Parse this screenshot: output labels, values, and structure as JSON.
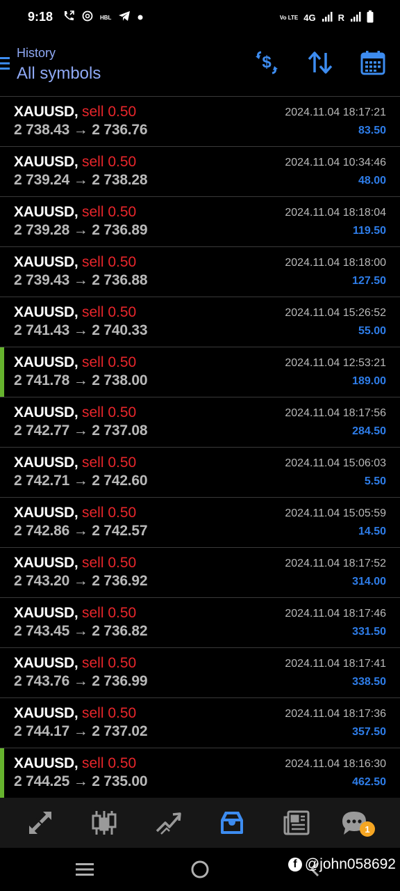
{
  "status_bar": {
    "time": "9:18",
    "left_icons": [
      "call-forward-icon",
      "threads-icon",
      "hbl-icon",
      "telegram-icon",
      "dot-icon"
    ],
    "hbl_text": "HBL",
    "volte_text": "Vo LTE",
    "network": "4G",
    "roaming": "R"
  },
  "header": {
    "subtitle": "History",
    "title": "All symbols",
    "accent_color": "#3d8cf0"
  },
  "deals": [
    {
      "symbol": "XAUUSD,",
      "side": "sell 0.50",
      "open": "2 738.43",
      "close": "2 736.76",
      "time": "2024.11.04 18:17:21",
      "profit": "83.50",
      "marked": false
    },
    {
      "symbol": "XAUUSD,",
      "side": "sell 0.50",
      "open": "2 739.24",
      "close": "2 738.28",
      "time": "2024.11.04 10:34:46",
      "profit": "48.00",
      "marked": false
    },
    {
      "symbol": "XAUUSD,",
      "side": "sell 0.50",
      "open": "2 739.28",
      "close": "2 736.89",
      "time": "2024.11.04 18:18:04",
      "profit": "119.50",
      "marked": false
    },
    {
      "symbol": "XAUUSD,",
      "side": "sell 0.50",
      "open": "2 739.43",
      "close": "2 736.88",
      "time": "2024.11.04 18:18:00",
      "profit": "127.50",
      "marked": false
    },
    {
      "symbol": "XAUUSD,",
      "side": "sell 0.50",
      "open": "2 741.43",
      "close": "2 740.33",
      "time": "2024.11.04 15:26:52",
      "profit": "55.00",
      "marked": false
    },
    {
      "symbol": "XAUUSD,",
      "side": "sell 0.50",
      "open": "2 741.78",
      "close": "2 738.00",
      "time": "2024.11.04 12:53:21",
      "profit": "189.00",
      "marked": true
    },
    {
      "symbol": "XAUUSD,",
      "side": "sell 0.50",
      "open": "2 742.77",
      "close": "2 737.08",
      "time": "2024.11.04 18:17:56",
      "profit": "284.50",
      "marked": false
    },
    {
      "symbol": "XAUUSD,",
      "side": "sell 0.50",
      "open": "2 742.71",
      "close": "2 742.60",
      "time": "2024.11.04 15:06:03",
      "profit": "5.50",
      "marked": false
    },
    {
      "symbol": "XAUUSD,",
      "side": "sell 0.50",
      "open": "2 742.86",
      "close": "2 742.57",
      "time": "2024.11.04 15:05:59",
      "profit": "14.50",
      "marked": false
    },
    {
      "symbol": "XAUUSD,",
      "side": "sell 0.50",
      "open": "2 743.20",
      "close": "2 736.92",
      "time": "2024.11.04 18:17:52",
      "profit": "314.00",
      "marked": false
    },
    {
      "symbol": "XAUUSD,",
      "side": "sell 0.50",
      "open": "2 743.45",
      "close": "2 736.82",
      "time": "2024.11.04 18:17:46",
      "profit": "331.50",
      "marked": false
    },
    {
      "symbol": "XAUUSD,",
      "side": "sell 0.50",
      "open": "2 743.76",
      "close": "2 736.99",
      "time": "2024.11.04 18:17:41",
      "profit": "338.50",
      "marked": false
    },
    {
      "symbol": "XAUUSD,",
      "side": "sell 0.50",
      "open": "2 744.17",
      "close": "2 737.02",
      "time": "2024.11.04 18:17:36",
      "profit": "357.50",
      "marked": false
    },
    {
      "symbol": "XAUUSD,",
      "side": "sell 0.50",
      "open": "2 744.25",
      "close": "2 735.00",
      "time": "2024.11.04 18:16:30",
      "profit": "462.50",
      "marked": true
    }
  ],
  "arrow": "→",
  "bottom_nav": {
    "items": [
      "quotes-icon",
      "chart-icon",
      "trade-icon",
      "history-icon",
      "news-icon",
      "chat-icon"
    ],
    "active": "history-icon",
    "chat_badge": "1"
  },
  "watermark": {
    "fb_letter": "f",
    "handle": "@john058692"
  },
  "colors": {
    "sell": "#e8262b",
    "profit": "#2e7de9",
    "marker": "#66b32e",
    "badge": "#f5a623"
  }
}
